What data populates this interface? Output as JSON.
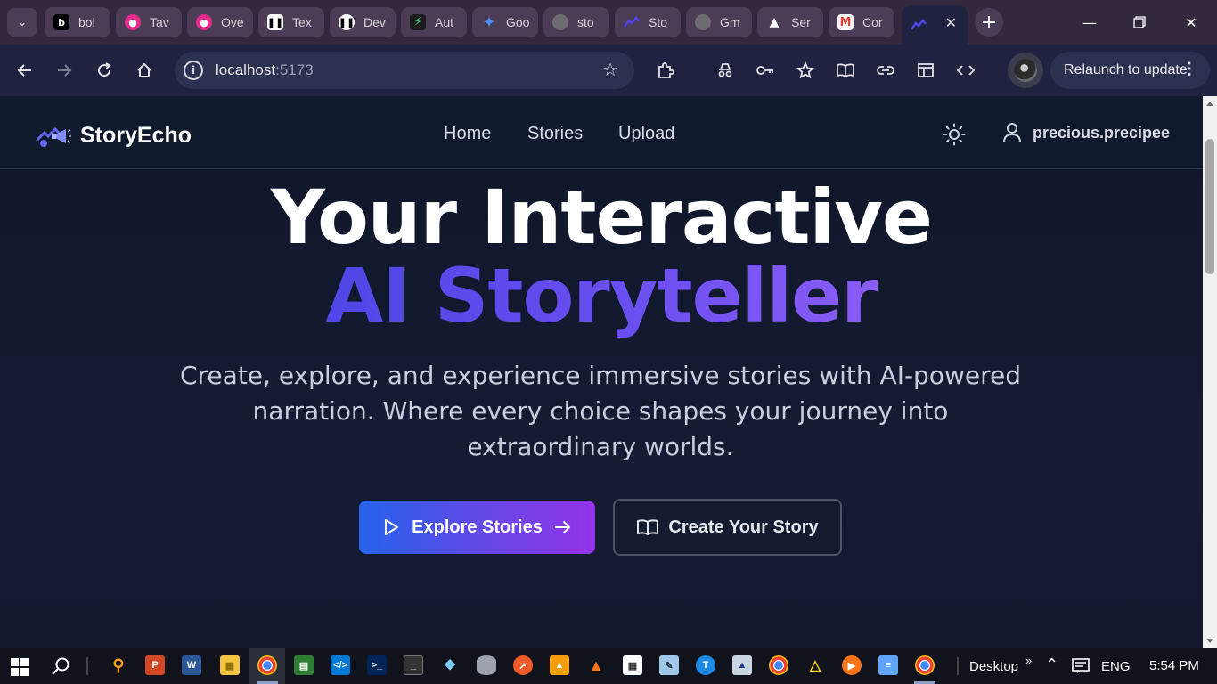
{
  "browser": {
    "tabs": [
      {
        "label": "bol",
        "favicon": "bolt-icon",
        "color": "#000000"
      },
      {
        "label": "Tav",
        "favicon": "tavus-icon",
        "color": "#e22b8a"
      },
      {
        "label": "Ove",
        "favicon": "overview-icon",
        "color": "#e22b8a"
      },
      {
        "label": "Tex",
        "favicon": "pause-icon",
        "color": "#ffffff"
      },
      {
        "label": "Dev",
        "favicon": "pause-circle-icon",
        "color": "#ffffff"
      },
      {
        "label": "Aut",
        "favicon": "supabase-icon",
        "color": "#3ecf8e"
      },
      {
        "label": "Goo",
        "favicon": "gemini-icon",
        "color": "#4f8cf7"
      },
      {
        "label": "sto",
        "favicon": "globe-icon",
        "color": "#8a8a8a"
      },
      {
        "label": "Sto",
        "favicon": "storyecho-icon",
        "color": "#4f46e5"
      },
      {
        "label": "Gm",
        "favicon": "globe-icon",
        "color": "#8a8a8a"
      },
      {
        "label": "Ser",
        "favicon": "render-icon",
        "color": "#ffffff"
      },
      {
        "label": "Cor",
        "favicon": "gmail-icon",
        "color": "#ea4335"
      }
    ],
    "active_tab_favicon": "storyecho-icon",
    "url_host": "localhost",
    "url_port": ":5173",
    "relaunch_label": "Relaunch to update"
  },
  "site": {
    "brand": "StoryEcho",
    "nav": {
      "home": "Home",
      "stories": "Stories",
      "upload": "Upload"
    },
    "username": "precious.precipee",
    "hero_line1": "Your Interactive",
    "hero_line2": "AI Storyteller",
    "lede": "Create, explore, and experience immersive stories with AI-powered narration. Where every choice shapes your journey into extraordinary worlds.",
    "primary_cta": "Explore Stories",
    "secondary_cta": "Create Your Story",
    "accent_gradient": [
      "#2563eb",
      "#9333ea"
    ]
  },
  "taskbar": {
    "desktop_label": "Desktop",
    "language": "ENG",
    "time": "5:54 PM"
  }
}
